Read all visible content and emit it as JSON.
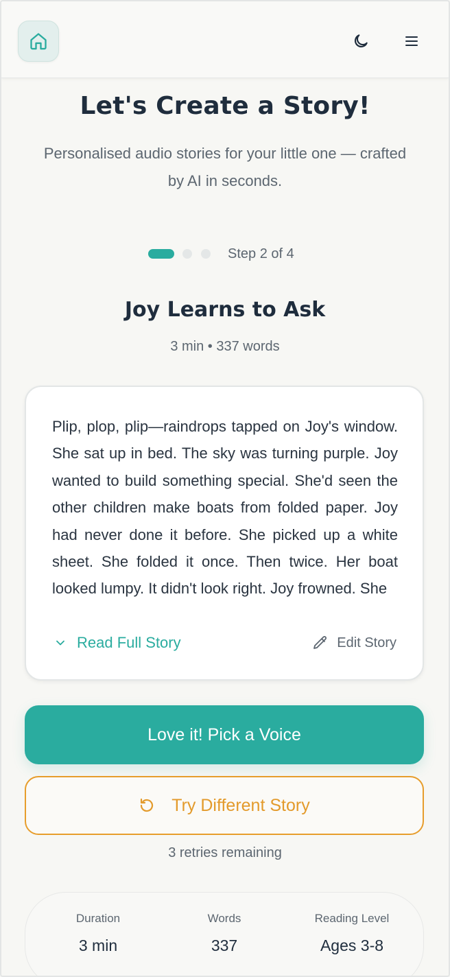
{
  "header": {
    "home_icon": "home-icon",
    "theme_icon": "moon-icon",
    "menu_icon": "hamburger-menu-icon"
  },
  "hero": {
    "title": "Let's Create a Story!",
    "subtitle": "Personalised audio stories for your little one — crafted by AI in seconds."
  },
  "progress": {
    "current_step": 2,
    "total_steps": 4,
    "label": "Step 2 of 4"
  },
  "story": {
    "title": "Joy Learns to Ask",
    "meta": "3 min • 337 words",
    "body": "Plip, plop, plip—raindrops tapped on Joy's window. She sat up in bed. The sky was turning purple. Joy wanted to build something special. She'd seen the other children make boats from folded paper. Joy had never done it before. She picked up a white sheet. She folded it once. Then twice. Her boat looked lumpy. It didn't look right. Joy frowned. She",
    "read_full_label": "Read Full Story",
    "edit_label": "Edit Story"
  },
  "actions": {
    "primary_label": "Love it! Pick a Voice",
    "secondary_label": "Try Different Story",
    "retries_text": "3 retries remaining"
  },
  "stats": [
    {
      "label": "Duration",
      "value": "3 min"
    },
    {
      "label": "Words",
      "value": "337"
    },
    {
      "label": "Reading Level",
      "value": "Ages 3-8"
    }
  ],
  "colors": {
    "accent": "#2aac9f",
    "secondary_accent": "#e79d2c",
    "text_dark": "#1f2d3d",
    "text_muted": "#5c6670"
  }
}
